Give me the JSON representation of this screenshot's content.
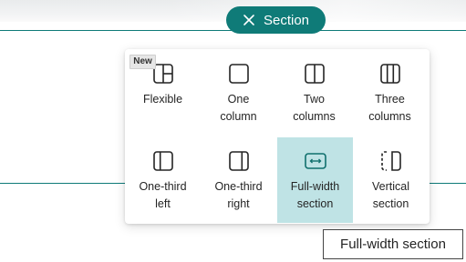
{
  "section_button": {
    "label": "Section",
    "icon": "close-icon",
    "color": "#0f7b78"
  },
  "layout_options": [
    {
      "id": "flexible",
      "icon": "flexible-layout-icon",
      "line1": "Flexible",
      "line2": "",
      "badge": "New"
    },
    {
      "id": "one-column",
      "icon": "one-column-icon",
      "line1": "One",
      "line2": "column"
    },
    {
      "id": "two-columns",
      "icon": "two-columns-icon",
      "line1": "Two",
      "line2": "columns"
    },
    {
      "id": "three-columns",
      "icon": "three-columns-icon",
      "line1": "Three",
      "line2": "columns"
    },
    {
      "id": "one-third-left",
      "icon": "one-third-left-icon",
      "line1": "One-third",
      "line2": "left"
    },
    {
      "id": "one-third-right",
      "icon": "one-third-right-icon",
      "line1": "One-third",
      "line2": "right"
    },
    {
      "id": "full-width-section",
      "icon": "full-width-icon",
      "line1": "Full-width",
      "line2": "section",
      "selected": true
    },
    {
      "id": "vertical-section",
      "icon": "vertical-section-icon",
      "line1": "Vertical",
      "line2": "section"
    }
  ],
  "tooltip": {
    "text": "Full-width section"
  },
  "colors": {
    "accent": "#0f7b78",
    "selected_bg": "#bfe3e5",
    "section_line": "#0e7a78"
  }
}
